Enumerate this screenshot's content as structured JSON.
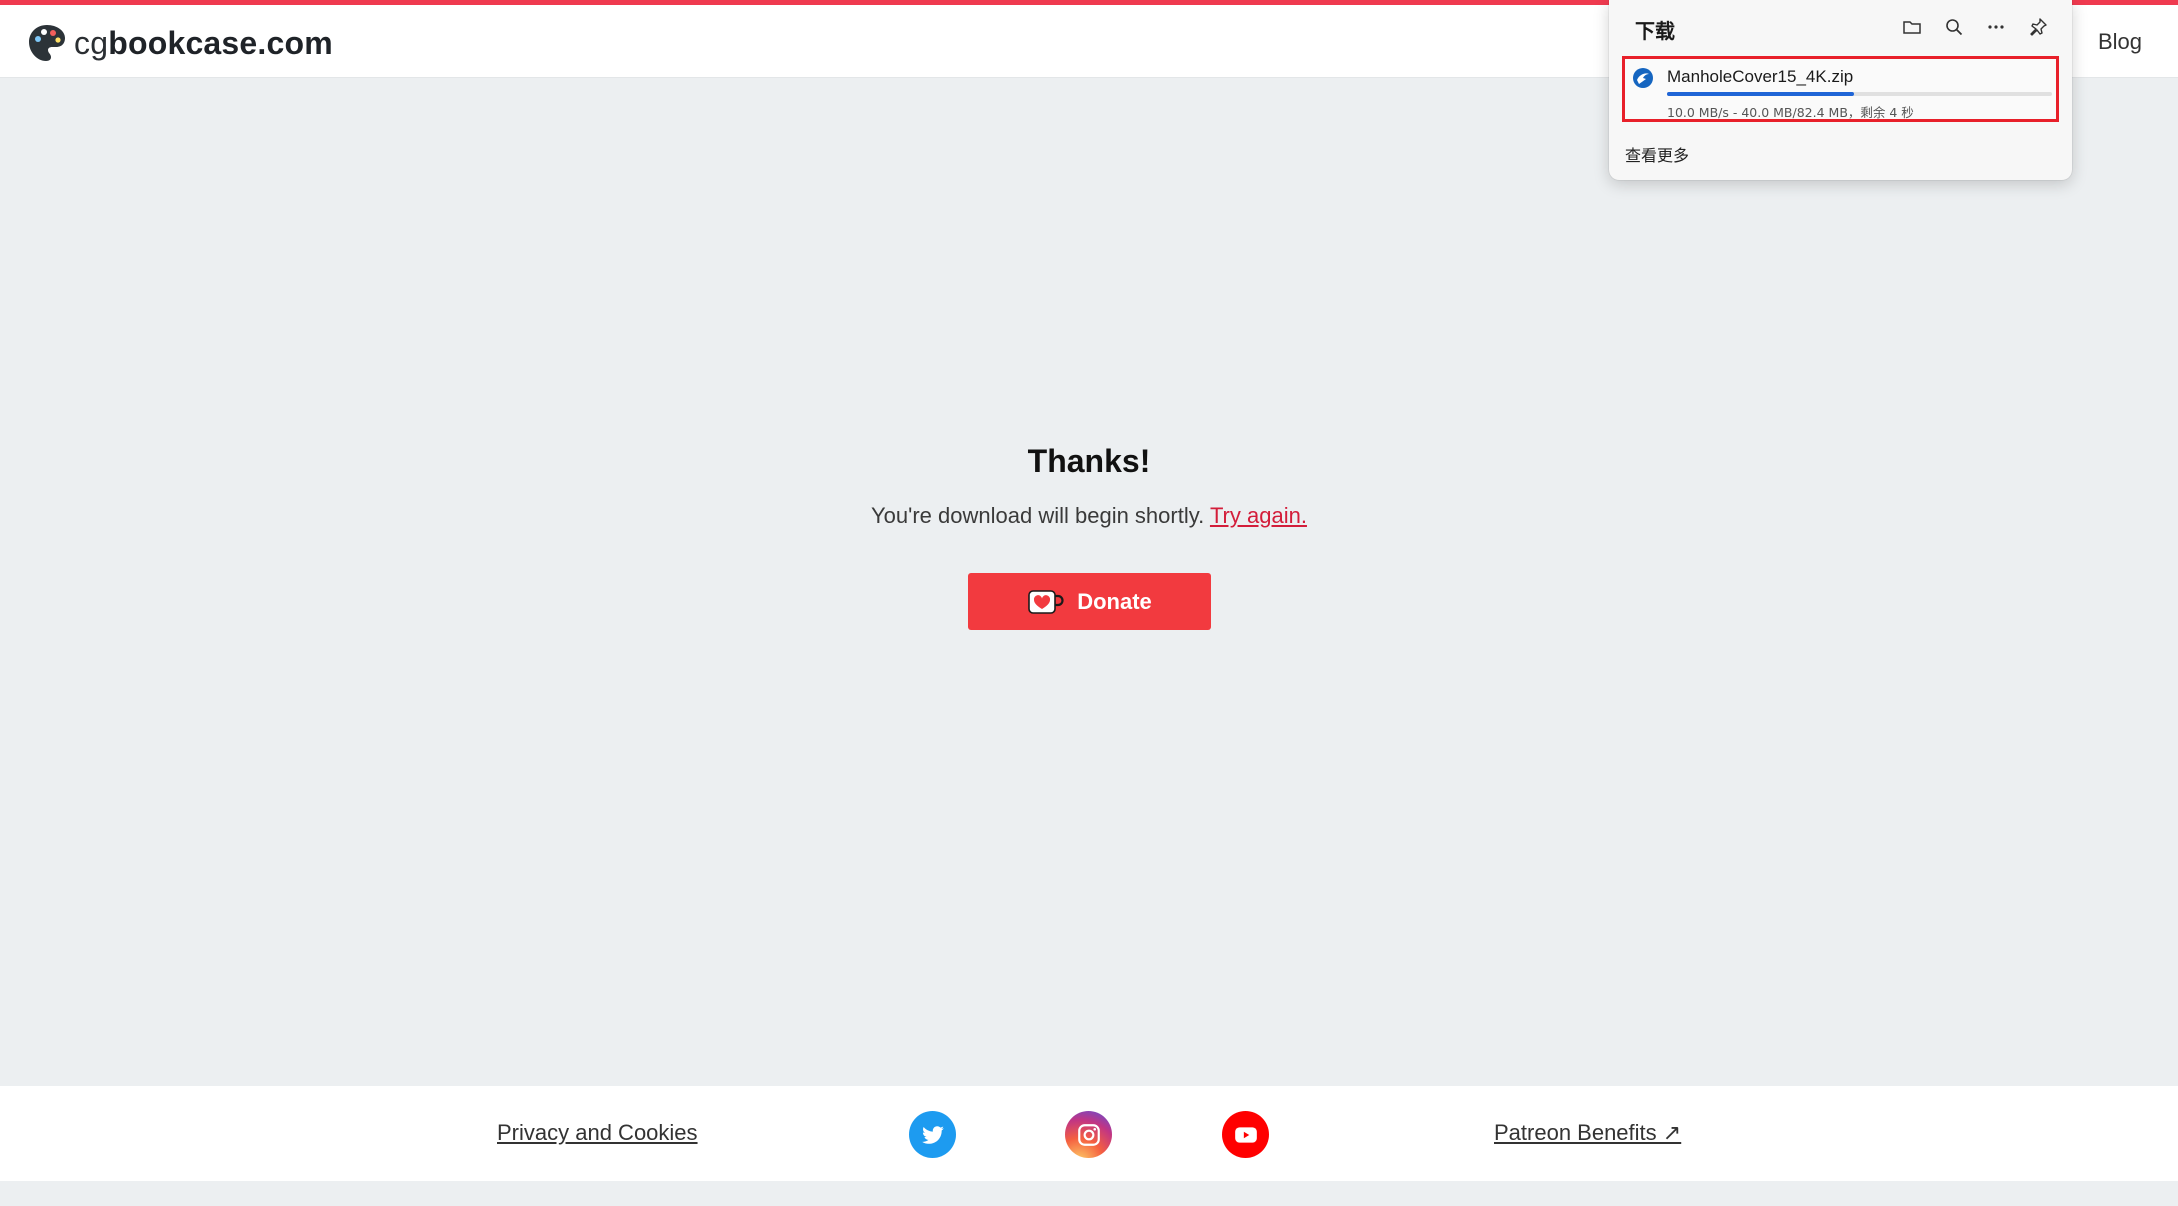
{
  "header": {
    "logo_prefix": "cg",
    "logo_main": "bookcase.com",
    "nav": {
      "blog": "Blog"
    }
  },
  "main": {
    "title": "Thanks!",
    "message": "You're download will begin shortly.",
    "retry_link": "Try again.",
    "donate_label": "Donate"
  },
  "footer": {
    "privacy": "Privacy and Cookies",
    "patreon": "Patreon Benefits ↗",
    "social_icons": [
      "twitter-icon",
      "instagram-icon",
      "youtube-icon"
    ]
  },
  "download_panel": {
    "title": "下载",
    "tool_icons": [
      "folder-icon",
      "search-icon",
      "more-icon",
      "pin-icon"
    ],
    "item": {
      "filename": "ManholeCover15_4K.zip",
      "status": "10.0 MB/s - 40.0 MB/82.4 MB，剩余 4 秒",
      "progress_fraction": 0.485
    },
    "see_more": "查看更多"
  },
  "colors": {
    "accent": "#ef3a4f",
    "donate": "#f23a3f",
    "link": "#d31d3a",
    "progress": "#1f65d6",
    "highlight_border": "#e8202a"
  }
}
